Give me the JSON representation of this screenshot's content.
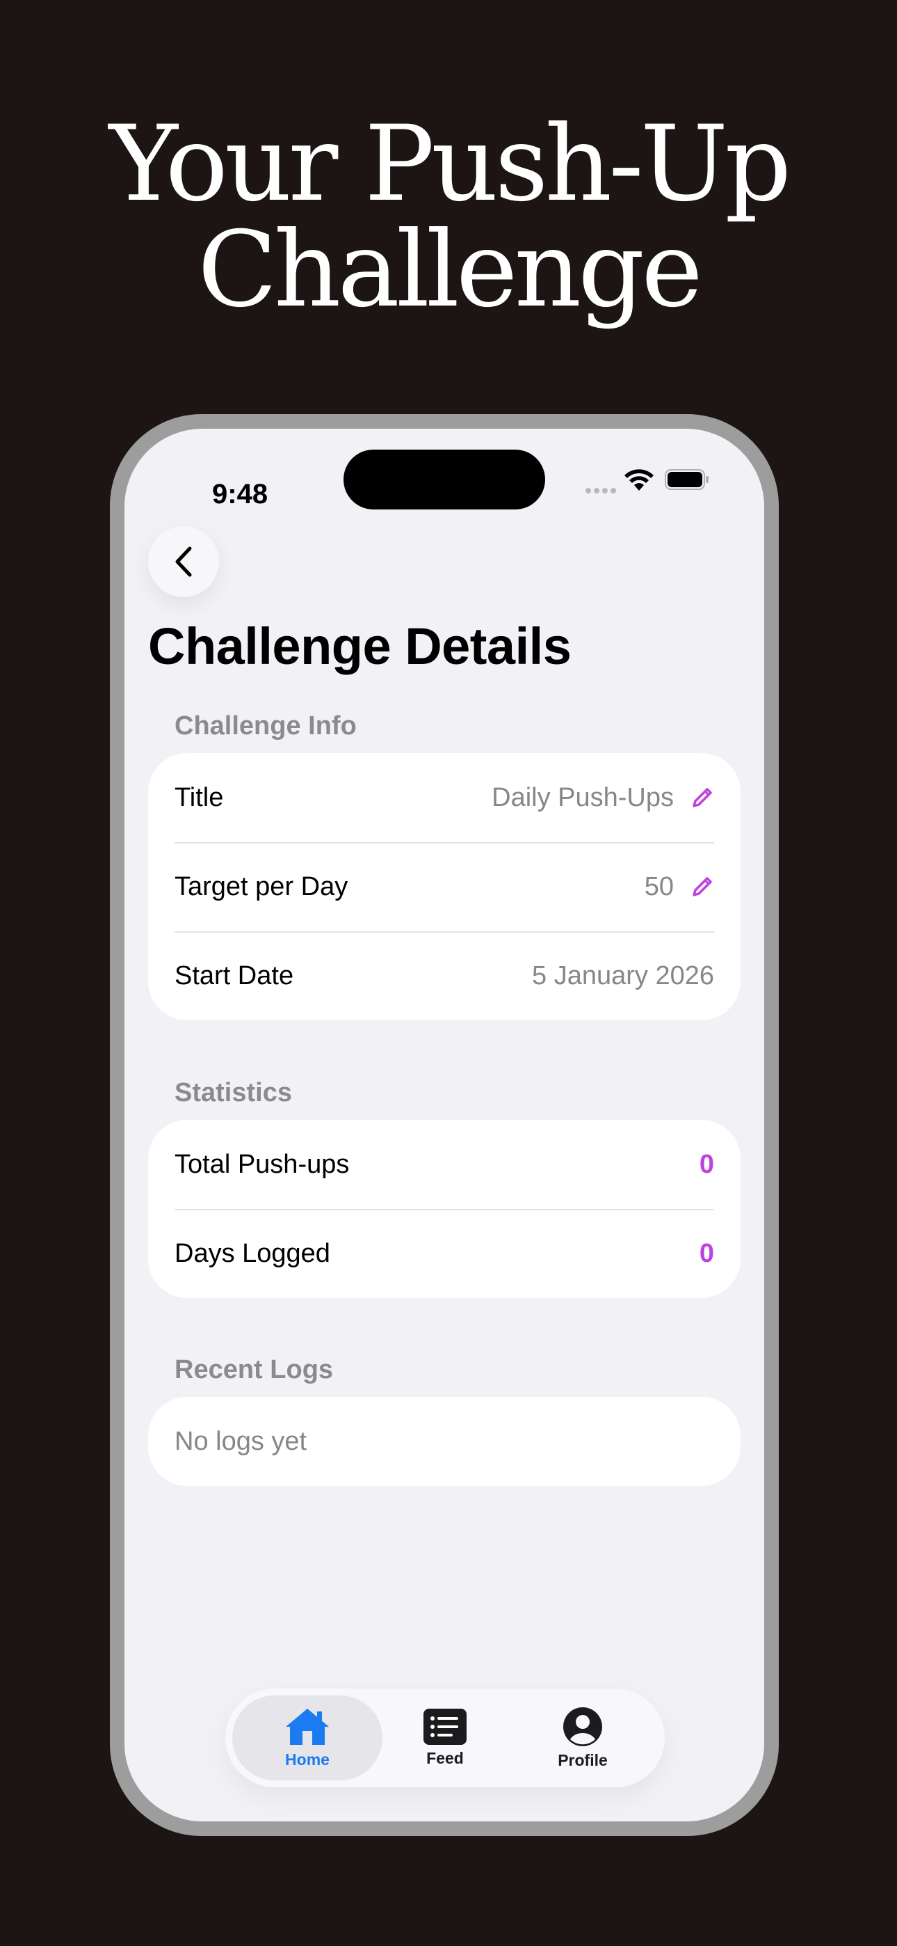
{
  "headline": {
    "line1": "Your Push-Up",
    "line2": "Challenge"
  },
  "status_bar": {
    "time": "9:48"
  },
  "page": {
    "title": "Challenge Details"
  },
  "challenge_info": {
    "section_label": "Challenge Info",
    "rows": [
      {
        "label": "Title",
        "value": "Daily Push-Ups",
        "editable": true
      },
      {
        "label": "Target per Day",
        "value": "50",
        "editable": true
      },
      {
        "label": "Start Date",
        "value": "5 January 2026",
        "editable": false
      }
    ]
  },
  "statistics": {
    "section_label": "Statistics",
    "rows": [
      {
        "label": "Total Push-ups",
        "value": "0"
      },
      {
        "label": "Days Logged",
        "value": "0"
      }
    ]
  },
  "recent_logs": {
    "section_label": "Recent Logs",
    "empty_text": "No logs yet"
  },
  "tab_bar": {
    "tabs": [
      {
        "label": "Home",
        "icon": "house-icon",
        "active": true
      },
      {
        "label": "Feed",
        "icon": "list-icon",
        "active": false
      },
      {
        "label": "Profile",
        "icon": "person-circle-icon",
        "active": false
      }
    ]
  },
  "colors": {
    "background": "#1c1514",
    "accent_purple": "#c03fe0",
    "accent_blue": "#1a7cf0",
    "screen_bg": "#f1f1f6"
  }
}
